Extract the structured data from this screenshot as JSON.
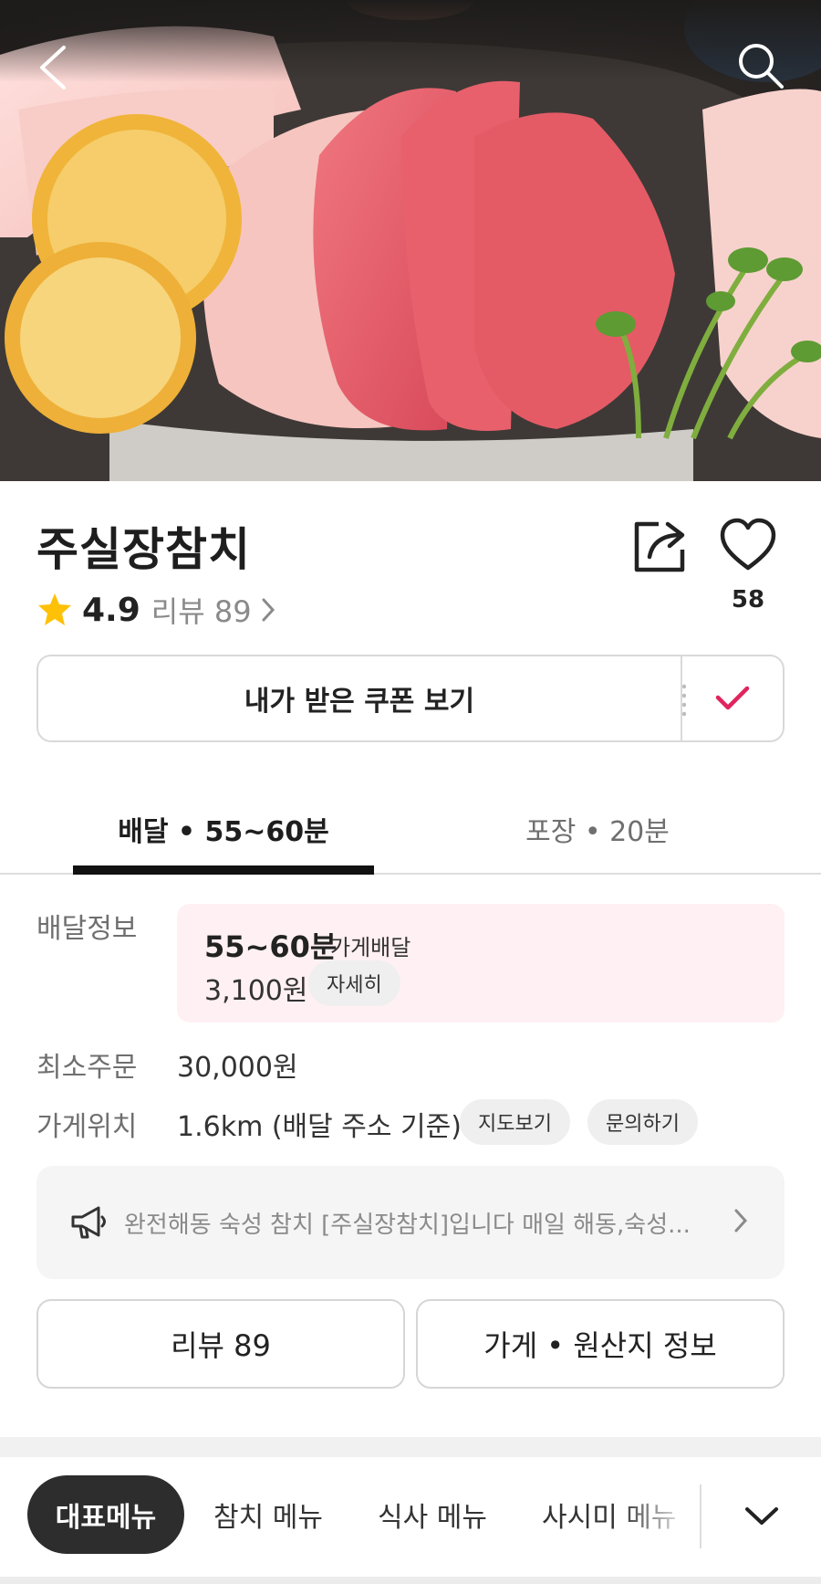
{
  "hero": {
    "alt": "tuna sashimi"
  },
  "store": {
    "name": "주실장참치",
    "rating": "4.9",
    "review_label": "리뷰 89",
    "like_count": "58"
  },
  "coupon": {
    "label": "내가 받은 쿠폰 보기"
  },
  "tabs": [
    {
      "label": "배달 • 55~60분",
      "active": true
    },
    {
      "label": "포장 • 20분",
      "active": false
    }
  ],
  "delivery": {
    "label": "배달정보",
    "time": "55~60분",
    "type": "가게배달",
    "fee": "3,100원",
    "detail_button": "자세히"
  },
  "min_order": {
    "label": "최소주문",
    "value": "30,000원"
  },
  "location": {
    "label": "가게위치",
    "value": "1.6km (배달 주소 기준)",
    "map_button": "지도보기",
    "inquiry_button": "문의하기"
  },
  "notice": {
    "text": "완전해동 숙성 참치 [주실장참치]입니다 매일 해동,숙성..."
  },
  "buttons": {
    "review": "리뷰 89",
    "store_info": "가게 • 원산지 정보"
  },
  "menu_categories": [
    "대표메뉴",
    "참치 메뉴",
    "식사 메뉴",
    "사시미 메뉴"
  ],
  "colors": {
    "accent_pink": "#e0245e",
    "star": "#ffc107",
    "delivery_box_bg": "#fff0f3"
  },
  "icons": [
    "back-icon",
    "search-icon",
    "share-icon",
    "heart-icon",
    "star-icon",
    "check-icon",
    "megaphone-icon",
    "chevron-right-icon",
    "chevron-down-icon"
  ]
}
